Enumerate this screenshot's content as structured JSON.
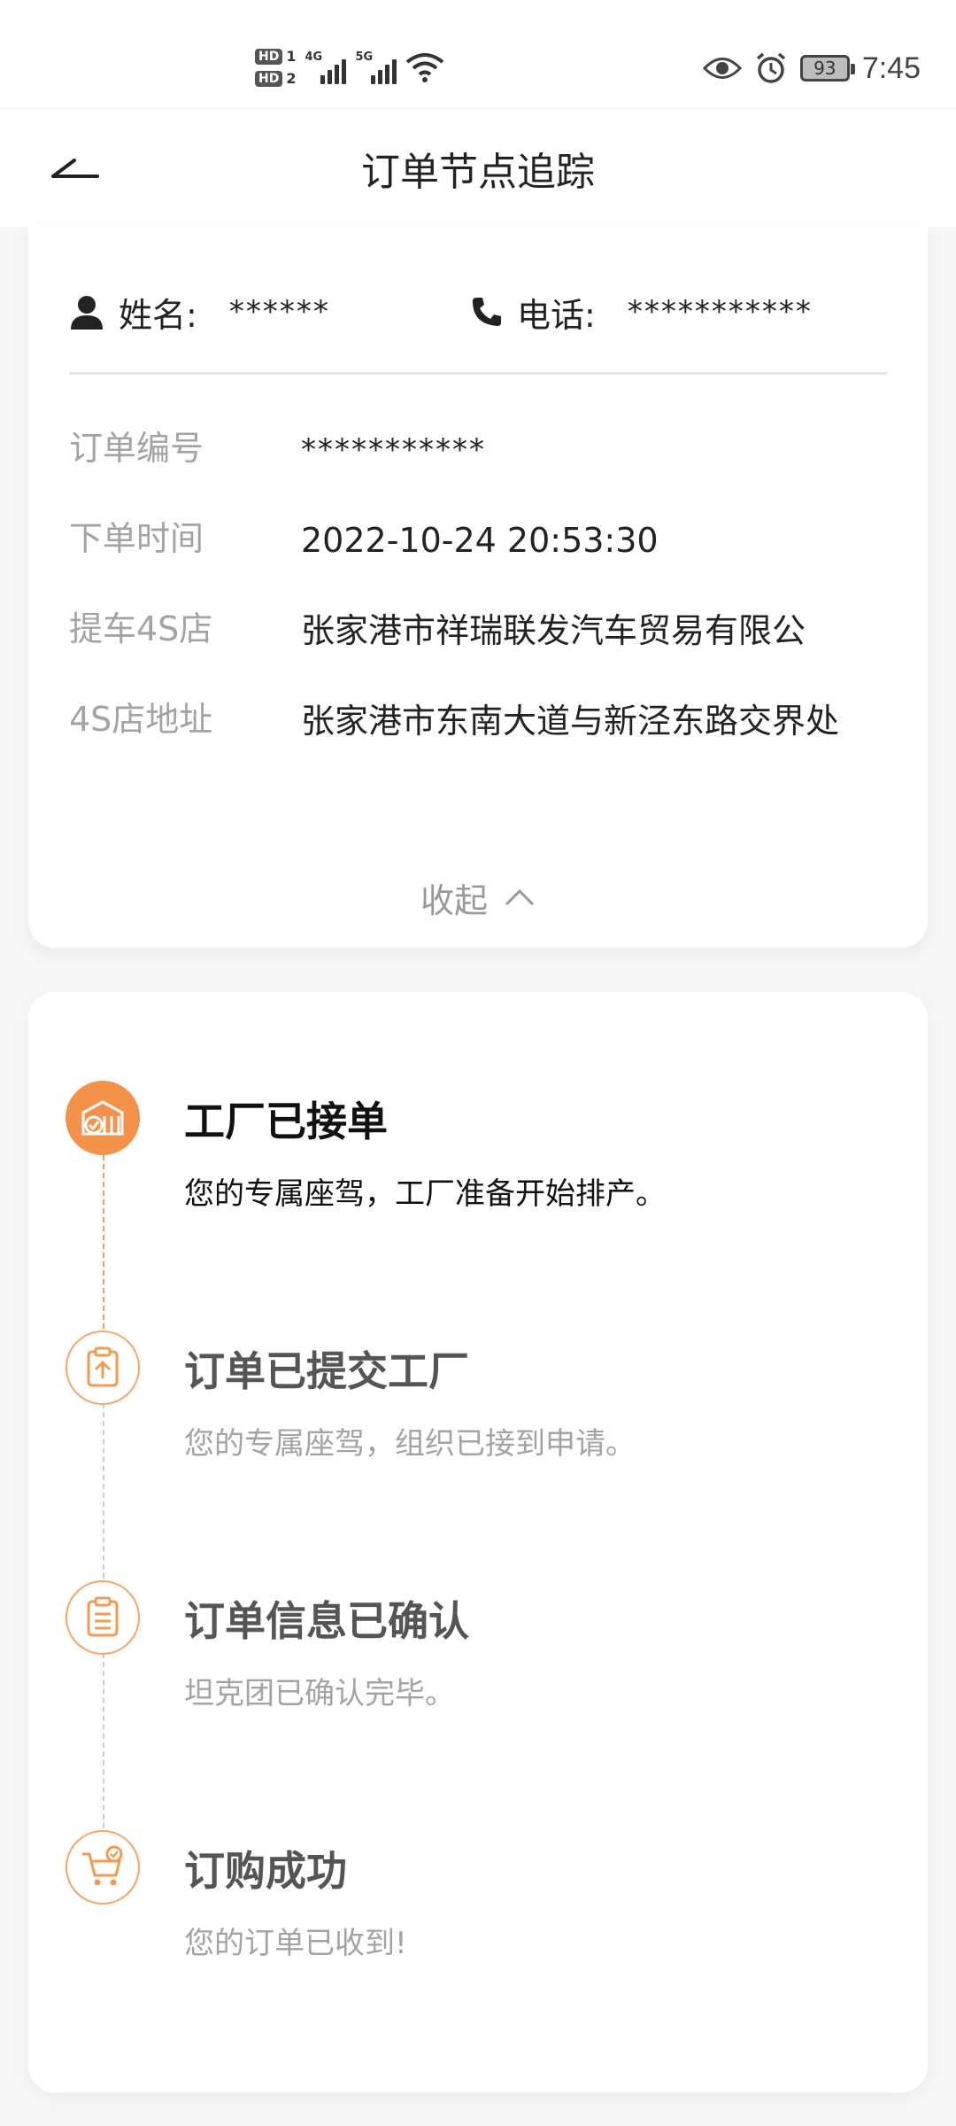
{
  "status_bar": {
    "sim1": "HD",
    "sim1_index": "1",
    "sim2": "HD",
    "sim2_index": "2",
    "net1": "4G",
    "net2": "5G",
    "battery": "93",
    "time": "7:45"
  },
  "nav": {
    "title": "订单节点追踪"
  },
  "contact": {
    "name_label": "姓名:",
    "name_value": "******",
    "phone_label": "电话:",
    "phone_value": "***********"
  },
  "order_info": [
    {
      "label": "订单编号",
      "value": "***********"
    },
    {
      "label": "下单时间",
      "value": "2022-10-24 20:53:30"
    },
    {
      "label": "提车4S店",
      "value": "张家港市祥瑞联发汽车贸易有限公"
    },
    {
      "label": "4S店地址",
      "value": "张家港市东南大道与新泾东路交界处"
    }
  ],
  "collapse_label": "收起",
  "timeline": [
    {
      "title": "工厂已接单",
      "desc": "您的专属座驾，工厂准备开始排产。",
      "active": true,
      "icon": "factory-icon"
    },
    {
      "title": "订单已提交工厂",
      "desc": "您的专属座驾，组织已接到申请。",
      "active": false,
      "icon": "clipboard-upload-icon"
    },
    {
      "title": "订单信息已确认",
      "desc": "坦克团已确认完毕。",
      "active": false,
      "icon": "clipboard-list-icon"
    },
    {
      "title": "订购成功",
      "desc": "您的订单已收到!",
      "active": false,
      "icon": "shopping-cart-check-icon"
    }
  ],
  "colors": {
    "accent": "#f5924a",
    "muted_text": "#a3a3a3"
  }
}
